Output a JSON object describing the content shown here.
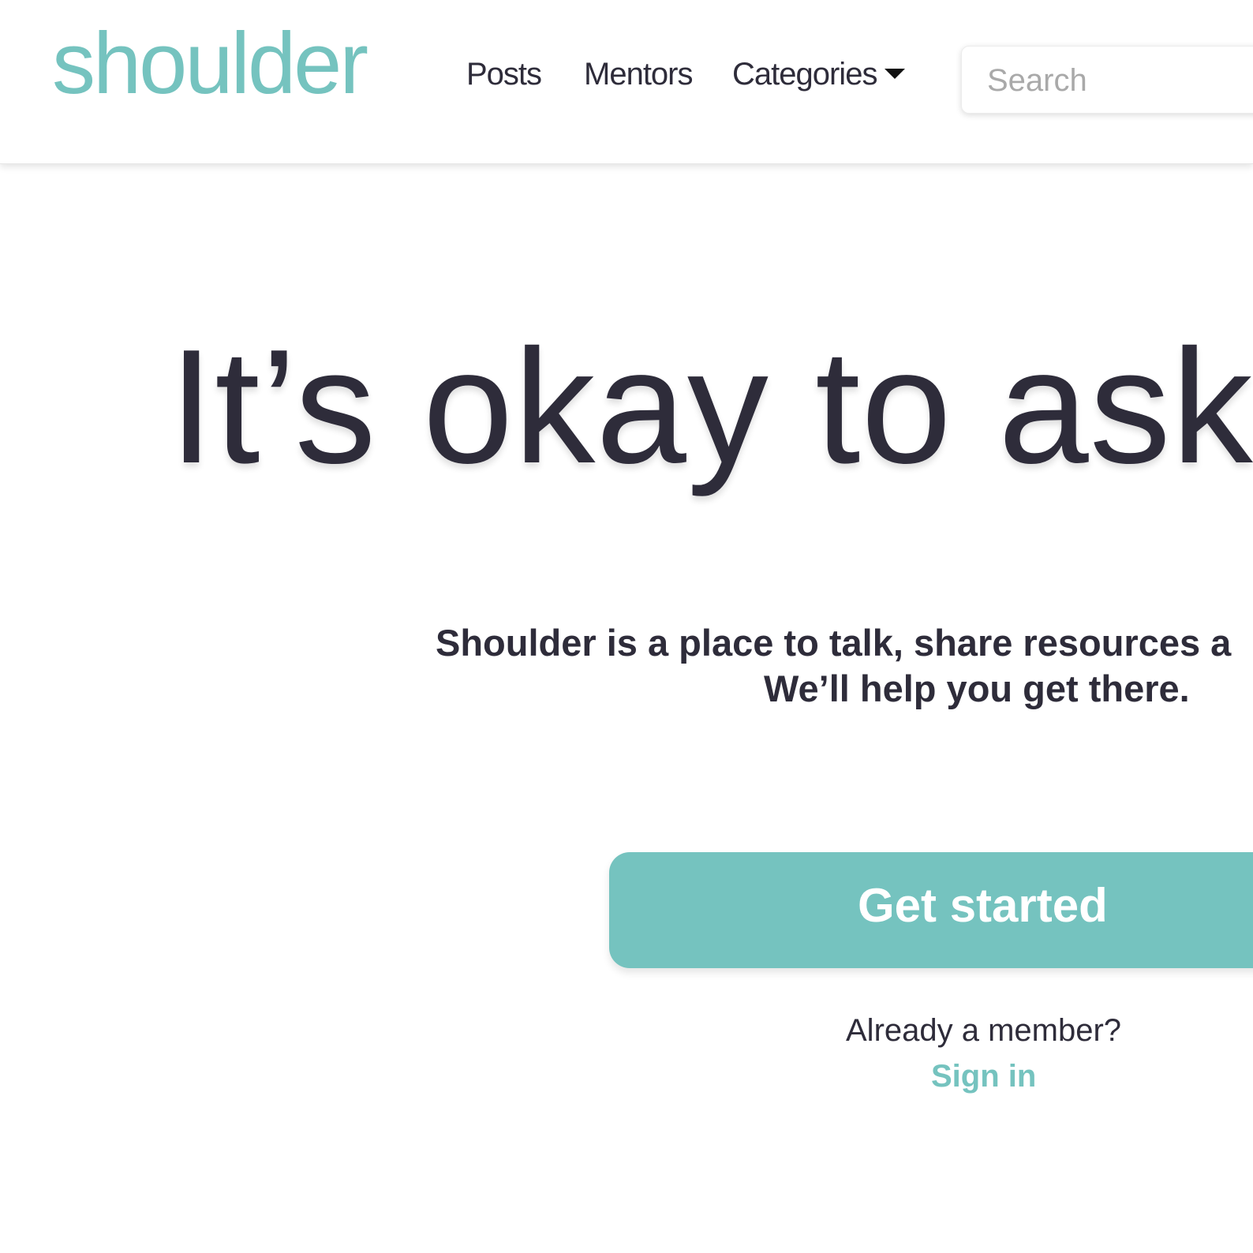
{
  "brand": {
    "logo_text": "shoulder",
    "accent_color": "#75c3bf",
    "text_color": "#2e2c3a"
  },
  "nav": {
    "posts_label": "Posts",
    "mentors_label": "Mentors",
    "categories_label": "Categories",
    "categories_icon": "caret-down-icon"
  },
  "search": {
    "placeholder": "Search",
    "value": ""
  },
  "hero": {
    "title": "It’s okay to ask",
    "tagline_line1": "Shoulder is a place to talk, share resources a",
    "tagline_line2": "We’ll help you get there.",
    "cta_label": "Get started",
    "member_prompt": "Already a member?",
    "signin_label": "Sign in"
  }
}
